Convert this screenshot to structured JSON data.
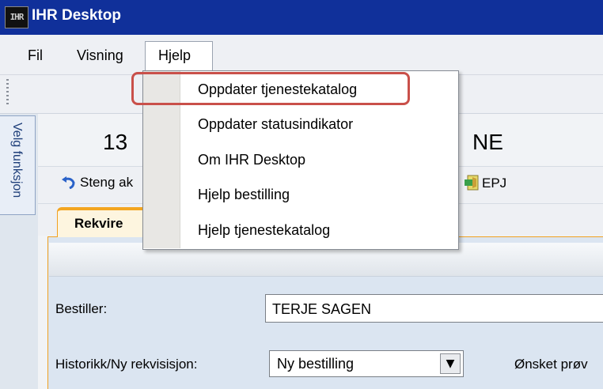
{
  "app": {
    "icon_text": "IHR",
    "title": "IHR Desktop"
  },
  "menubar": {
    "items": [
      "Fil",
      "Visning",
      "Hjelp"
    ]
  },
  "side_tab": {
    "label": "Velg funksjon"
  },
  "main": {
    "heading_start": "13",
    "heading_end": "NE",
    "actions": {
      "close_partial": "Steng ak",
      "epj": "EPJ"
    },
    "tab": {
      "label": "Rekvire"
    },
    "fields": {
      "bestiller_label": "Bestiller:",
      "bestiller_value": "TERJE SAGEN",
      "historikk_label": "Historikk/Ny rekvisisjon:",
      "historikk_value": "Ny bestilling",
      "onsket_label": "Ønsket prøv"
    }
  },
  "dropdown": {
    "items": [
      "Oppdater tjenestekatalog",
      "Oppdater statusindikator",
      "Om IHR Desktop",
      "Hjelp bestilling",
      "Hjelp tjenestekatalog"
    ],
    "highlight_color": "#c9504a"
  },
  "colors": {
    "titlebar": "#10309a",
    "tab_accent": "#f3a520"
  }
}
